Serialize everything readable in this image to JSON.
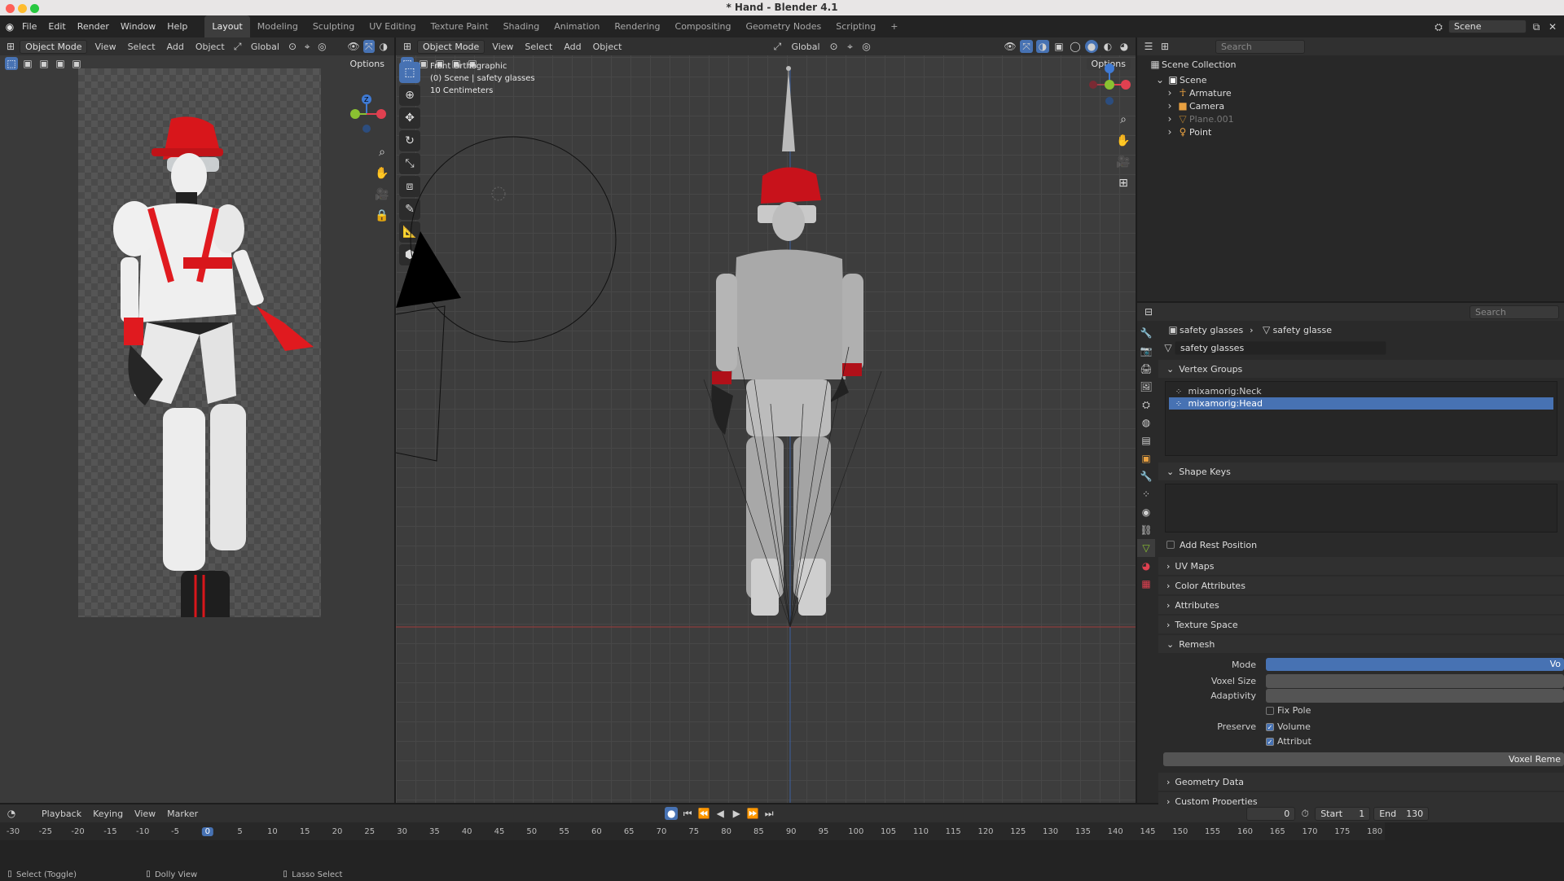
{
  "window": {
    "title": "* Hand - Blender 4.1"
  },
  "menu": [
    "File",
    "Edit",
    "Render",
    "Window",
    "Help"
  ],
  "workspaces": [
    {
      "label": "Layout",
      "active": true
    },
    {
      "label": "Modeling"
    },
    {
      "label": "Sculpting"
    },
    {
      "label": "UV Editing"
    },
    {
      "label": "Texture Paint"
    },
    {
      "label": "Shading"
    },
    {
      "label": "Animation"
    },
    {
      "label": "Rendering"
    },
    {
      "label": "Compositing"
    },
    {
      "label": "Geometry Nodes"
    },
    {
      "label": "Scripting"
    }
  ],
  "add_workspace": "+",
  "scene": {
    "label": "Scene"
  },
  "left_view": {
    "mode": "Object Mode",
    "menus": [
      "View",
      "Select",
      "Add",
      "Object"
    ],
    "orientation": "Global",
    "options": "Options"
  },
  "right_view": {
    "mode": "Object Mode",
    "menus": [
      "View",
      "Select",
      "Add",
      "Object"
    ],
    "orientation": "Global",
    "options": "Options",
    "overlay": [
      "Front Orthographic",
      "(0) Scene | safety glasses",
      "10 Centimeters"
    ]
  },
  "outliner": {
    "search": "Search",
    "root": "Scene Collection",
    "collection": "Scene",
    "items": [
      "Armature",
      "Camera",
      "Plane.001",
      "Point"
    ]
  },
  "properties": {
    "search": "Search",
    "breadcrumb": [
      "safety glasses",
      "safety glasse"
    ],
    "mesh_name": "safety glasses",
    "vertex_groups_title": "Vertex Groups",
    "vertex_groups": [
      "mixamorig:Neck",
      "mixamorig:Head"
    ],
    "shape_keys_title": "Shape Keys",
    "add_rest": "Add Rest Position",
    "collapsed": [
      "UV Maps",
      "Color Attributes",
      "Attributes",
      "Texture Space"
    ],
    "remesh_title": "Remesh",
    "mode_label": "Mode",
    "mode_value": "Vo",
    "voxel_size": "Voxel Size",
    "adaptivity": "Adaptivity",
    "fix_poles": "Fix Pole",
    "preserve": "Preserve",
    "volume": "Volume",
    "attributes": "Attribut",
    "remesh_button": "Voxel Reme",
    "geometry_data": "Geometry Data",
    "custom_props": "Custom Properties"
  },
  "timeline": {
    "menus": [
      "Playback",
      "Keying",
      "View",
      "Marker"
    ],
    "current": "0",
    "start_label": "Start",
    "start": "1",
    "end_label": "End",
    "end": "130",
    "ticks": [
      "-30",
      "-25",
      "-20",
      "-15",
      "-10",
      "-5",
      "0",
      "5",
      "10",
      "15",
      "20",
      "25",
      "30",
      "35",
      "40",
      "45",
      "50",
      "55",
      "60",
      "65",
      "70",
      "75",
      "80",
      "85",
      "90",
      "95",
      "100",
      "105",
      "110",
      "115",
      "120",
      "125",
      "130",
      "135",
      "140",
      "145",
      "150",
      "155",
      "160",
      "165",
      "170",
      "175",
      "180"
    ]
  },
  "status": [
    "Select (Toggle)",
    "Dolly View",
    "Lasso Select"
  ],
  "colors": {
    "accent": "#4772b3",
    "helmet": "#d8161b",
    "x_axis": "#e04050",
    "y_axis": "#8ac231",
    "z_axis": "#3f7ad4"
  }
}
